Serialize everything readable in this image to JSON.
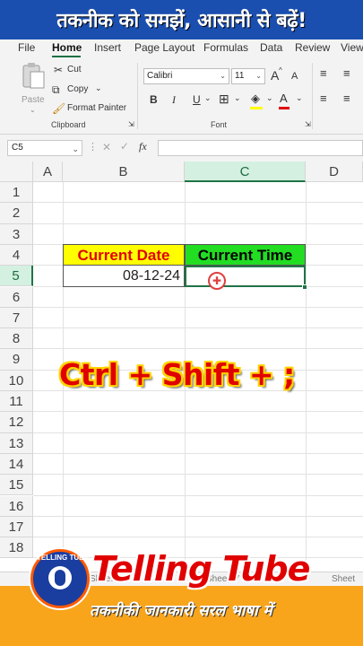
{
  "banner": {
    "text": "तकनीक को समझें, आसानी से बढ़ें!"
  },
  "menu": {
    "items": [
      "File",
      "Home",
      "Insert",
      "Page Layout",
      "Formulas",
      "Data",
      "Review",
      "View"
    ]
  },
  "ribbon": {
    "clipboard": {
      "paste": "Paste",
      "cut": "Cut",
      "copy": "Copy",
      "format_painter": "Format Painter",
      "group": "Clipboard"
    },
    "font": {
      "name": "Calibri",
      "size": "11",
      "grow": "A",
      "shrink": "A",
      "bold": "B",
      "italic": "I",
      "underline": "U",
      "group": "Font"
    }
  },
  "formula_bar": {
    "name_box": "C5",
    "fx": "fx"
  },
  "grid": {
    "columns": [
      "A",
      "B",
      "C",
      "D"
    ],
    "rows": [
      "1",
      "2",
      "3",
      "4",
      "5",
      "6",
      "7",
      "8",
      "9",
      "10",
      "11",
      "12",
      "13",
      "14",
      "15",
      "16",
      "17",
      "18"
    ],
    "b4": "Current Date",
    "c4": "Current Time",
    "b5": "08-12-24"
  },
  "overlay": {
    "shortcut": "Ctrl + Shift + ;"
  },
  "sheet_tabs": [
    "Sheet",
    "Sheet17",
    "Sheet"
  ],
  "footer": {
    "logo_text": "TELLING TUBE",
    "brand": "Telling Tube",
    "tagline": "तकनीकी जानकारी सरल भाषा में"
  },
  "colors": {
    "excel_green": "#217346",
    "header_yellow": "#ffff00",
    "header_green": "#22dd22",
    "footer_orange": "#f8a51c"
  }
}
